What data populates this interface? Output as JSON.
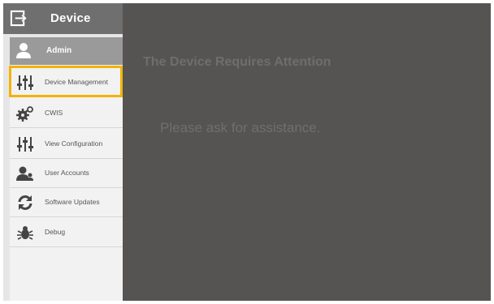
{
  "sidebar": {
    "title": "Device",
    "user": {
      "name": "Admin"
    },
    "items": [
      {
        "label": "Device Management",
        "icon": "sliders-icon"
      },
      {
        "label": "CWIS",
        "icon": "gears-icon"
      },
      {
        "label": "View Configuration",
        "icon": "sliders-icon"
      },
      {
        "label": "User Accounts",
        "icon": "users-icon"
      },
      {
        "label": "Software Updates",
        "icon": "refresh-icon"
      },
      {
        "label": "Debug",
        "icon": "bug-icon"
      }
    ]
  },
  "main": {
    "heading": "The Device Requires Attention",
    "message": "Please ask for assistance."
  },
  "colors": {
    "header": "#6f6f6f",
    "main_background": "#555452",
    "highlight": "#f2b400"
  }
}
